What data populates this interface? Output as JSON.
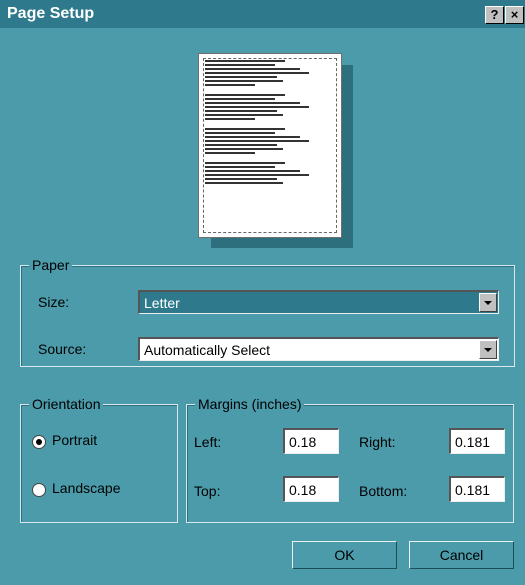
{
  "window": {
    "title": "Page Setup",
    "help_label": "?",
    "close_label": "×"
  },
  "paper": {
    "group_label": "Paper",
    "size_label": "Size:",
    "size_value": "Letter",
    "source_label": "Source:",
    "source_value": "Automatically Select"
  },
  "orientation": {
    "group_label": "Orientation",
    "portrait_label": "Portrait",
    "landscape_label": "Landscape",
    "selected": "Portrait"
  },
  "margins": {
    "group_label": "Margins (inches)",
    "left_label": "Left:",
    "left_value": "0.18",
    "right_label": "Right:",
    "right_value": "0.181",
    "top_label": "Top:",
    "top_value": "0.18",
    "bottom_label": "Bottom:",
    "bottom_value": "0.181"
  },
  "buttons": {
    "ok_label": "OK",
    "cancel_label": "Cancel"
  },
  "icons": {
    "dropdown": "chevron-down-icon",
    "radio": "radio-icon"
  },
  "colors": {
    "background": "#4b9bab",
    "titlebar": "#2e7a8c",
    "selection": "#2e7a8c"
  }
}
